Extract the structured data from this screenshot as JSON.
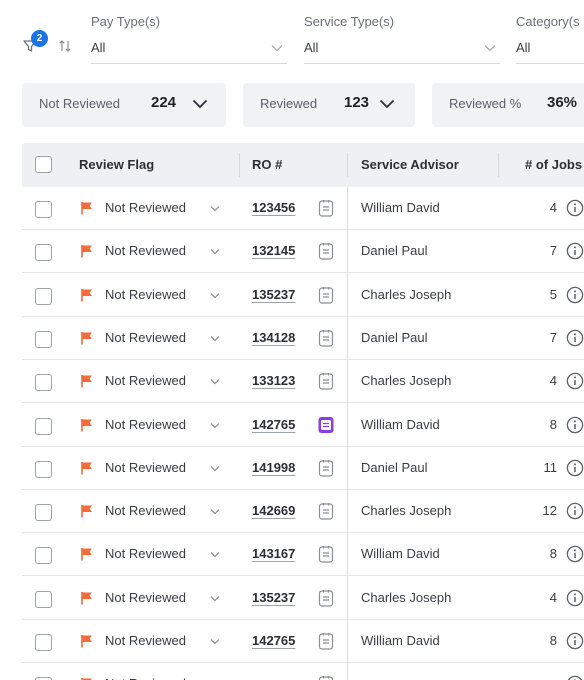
{
  "filters": {
    "active_count": "2",
    "pay_type": {
      "label": "Pay Type(s)",
      "value": "All"
    },
    "service_type": {
      "label": "Service Type(s)",
      "value": "All"
    },
    "category": {
      "label": "Category(s",
      "value": "All"
    }
  },
  "summary": {
    "not_reviewed": {
      "label": "Not Reviewed",
      "value": "224"
    },
    "reviewed": {
      "label": "Reviewed",
      "value": "123"
    },
    "reviewed_pct": {
      "label": "Reviewed %",
      "value": "36%"
    }
  },
  "table": {
    "headers": {
      "review_flag": "Review Flag",
      "ro": "RO #",
      "advisor": "Service Advisor",
      "jobs": "# of Jobs"
    },
    "rows": [
      {
        "status": "Not Reviewed",
        "ro": "123456",
        "advisor": "William David",
        "jobs": "4",
        "doc_highlight": false
      },
      {
        "status": "Not Reviewed",
        "ro": "132145",
        "advisor": "Daniel Paul",
        "jobs": "7",
        "doc_highlight": false
      },
      {
        "status": "Not Reviewed",
        "ro": "135237",
        "advisor": "Charles Joseph",
        "jobs": "5",
        "doc_highlight": false
      },
      {
        "status": "Not Reviewed",
        "ro": "134128",
        "advisor": "Daniel Paul",
        "jobs": "7",
        "doc_highlight": false
      },
      {
        "status": "Not Reviewed",
        "ro": "133123",
        "advisor": "Charles Joseph",
        "jobs": "4",
        "doc_highlight": false
      },
      {
        "status": "Not Reviewed",
        "ro": "142765",
        "advisor": "William David",
        "jobs": "8",
        "doc_highlight": true
      },
      {
        "status": "Not Reviewed",
        "ro": "141998",
        "advisor": "Daniel Paul",
        "jobs": "11",
        "doc_highlight": false
      },
      {
        "status": "Not Reviewed",
        "ro": "142669",
        "advisor": "Charles Joseph",
        "jobs": "12",
        "doc_highlight": false
      },
      {
        "status": "Not Reviewed",
        "ro": "143167",
        "advisor": "William David",
        "jobs": "8",
        "doc_highlight": false
      },
      {
        "status": "Not Reviewed",
        "ro": "135237",
        "advisor": "Charles Joseph",
        "jobs": "4",
        "doc_highlight": false
      },
      {
        "status": "Not Reviewed",
        "ro": "142765",
        "advisor": "William David",
        "jobs": "8",
        "doc_highlight": false
      },
      {
        "status": "Not Reviewed",
        "ro": "",
        "advisor": "",
        "jobs": "",
        "doc_highlight": false
      }
    ]
  },
  "colors": {
    "flag": "#f26b3a",
    "doc_highlight": "#8b3fe0",
    "badge": "#1a73e8"
  },
  "icons": [
    "filter-icon",
    "sort-icon",
    "chevron-down-icon",
    "flag-icon",
    "document-icon",
    "info-icon"
  ]
}
